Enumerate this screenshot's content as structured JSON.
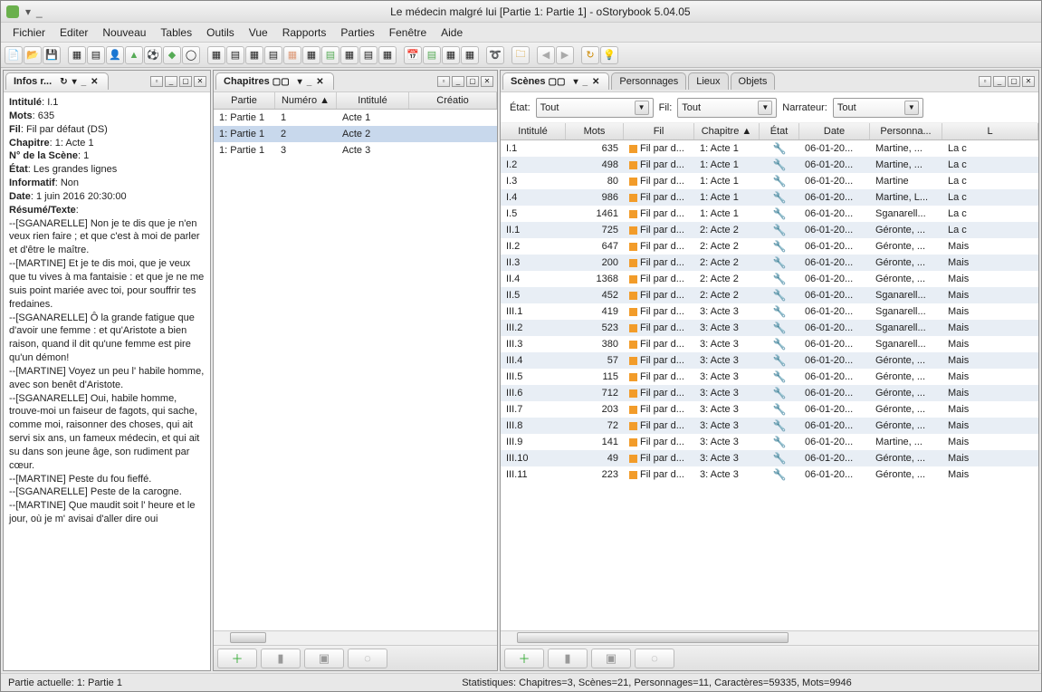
{
  "title": "Le médecin malgré lui [Partie 1: Partie 1] - oStorybook 5.04.05",
  "menubar": [
    "Fichier",
    "Editer",
    "Nouveau",
    "Tables",
    "Outils",
    "Vue",
    "Rapports",
    "Parties",
    "Fenêtre",
    "Aide"
  ],
  "panels": {
    "infos": {
      "title": "Infos r..."
    },
    "chaps": {
      "title": "Chapitres"
    },
    "scenes": {
      "tabs": [
        "Scènes",
        "Personnages",
        "Lieux",
        "Objets"
      ]
    }
  },
  "info": {
    "intitule_lbl": "Intitulé",
    "intitule": "I.1",
    "mots_lbl": "Mots",
    "mots": "635",
    "fil_lbl": "Fil",
    "fil": "Fil par défaut (DS)",
    "chapitre_lbl": "Chapitre",
    "chapitre": "1: Acte 1",
    "numscene_lbl": "N° de la Scène",
    "numscene": "1",
    "etat_lbl": "État",
    "etat": "Les grandes lignes",
    "informatif_lbl": "Informatif",
    "informatif": "Non",
    "date_lbl": "Date",
    "date": "1 juin 2016 20:30:00",
    "resume_lbl": "Résumé/Texte",
    "body": "--[SGANARELLE] Non je te dis que je n'en veux rien faire ; et que c'est à moi de parler et d'être le maître.\n--[MARTINE] Et je te dis moi, que je veux que tu vives à ma fantaisie : et que je ne me suis point mariée avec toi, pour souffrir tes fredaines.\n--[SGANARELLE] Ô la grande fatigue que d'avoir une femme : et qu'Aristote a bien raison, quand il dit qu'une femme est pire qu'un démon!\n--[MARTINE] Voyez un peu l' habile homme, avec son benêt d'Aristote.\n--[SGANARELLE] Oui, habile homme, trouve-moi un faiseur de fagots, qui sache, comme moi, raisonner des choses, qui ait servi six ans, un fameux médecin, et qui ait su dans son jeune âge, son rudiment par cœur.\n--[MARTINE] Peste du fou fieffé.\n--[SGANARELLE] Peste de la carogne.\n--[MARTINE] Que maudit soit l' heure et le jour, où je m' avisai d'aller dire oui"
  },
  "chap_cols": {
    "partie": "Partie",
    "num": "Numéro ▲",
    "int": "Intitulé",
    "cre": "Créatio"
  },
  "chapters": [
    {
      "partie": "1: Partie 1",
      "num": "1",
      "int": "Acte 1"
    },
    {
      "partie": "1: Partie 1",
      "num": "2",
      "int": "Acte 2"
    },
    {
      "partie": "1: Partie 1",
      "num": "3",
      "int": "Acte 3"
    }
  ],
  "filters": {
    "etat_lbl": "État:",
    "etat": "Tout",
    "fil_lbl": "Fil:",
    "fil": "Tout",
    "narr_lbl": "Narrateur:",
    "narr": "Tout"
  },
  "scene_cols": {
    "int": "Intitulé",
    "mots": "Mots",
    "fil": "Fil",
    "chap": "Chapitre ▲",
    "etat": "État",
    "date": "Date",
    "pers": "Personna...",
    "lieu": "L"
  },
  "scenes": [
    {
      "int": "I.1",
      "mots": "635",
      "fil": "Fil par d...",
      "chap": "1: Acte 1",
      "date": "06-01-20...",
      "pers": "Martine, ...",
      "lieu": "La c"
    },
    {
      "int": "I.2",
      "mots": "498",
      "fil": "Fil par d...",
      "chap": "1: Acte 1",
      "date": "06-01-20...",
      "pers": "Martine, ...",
      "lieu": "La c"
    },
    {
      "int": "I.3",
      "mots": "80",
      "fil": "Fil par d...",
      "chap": "1: Acte 1",
      "date": "06-01-20...",
      "pers": "Martine",
      "lieu": "La c"
    },
    {
      "int": "I.4",
      "mots": "986",
      "fil": "Fil par d...",
      "chap": "1: Acte 1",
      "date": "06-01-20...",
      "pers": "Martine, L...",
      "lieu": "La c"
    },
    {
      "int": "I.5",
      "mots": "1461",
      "fil": "Fil par d...",
      "chap": "1: Acte 1",
      "date": "06-01-20...",
      "pers": "Sganarell...",
      "lieu": "La c"
    },
    {
      "int": "II.1",
      "mots": "725",
      "fil": "Fil par d...",
      "chap": "2: Acte 2",
      "date": "06-01-20...",
      "pers": "Géronte, ...",
      "lieu": "La c"
    },
    {
      "int": "II.2",
      "mots": "647",
      "fil": "Fil par d...",
      "chap": "2: Acte 2",
      "date": "06-01-20...",
      "pers": "Géronte, ...",
      "lieu": "Mais"
    },
    {
      "int": "II.3",
      "mots": "200",
      "fil": "Fil par d...",
      "chap": "2: Acte 2",
      "date": "06-01-20...",
      "pers": "Géronte, ...",
      "lieu": "Mais"
    },
    {
      "int": "II.4",
      "mots": "1368",
      "fil": "Fil par d...",
      "chap": "2: Acte 2",
      "date": "06-01-20...",
      "pers": "Géronte, ...",
      "lieu": "Mais"
    },
    {
      "int": "II.5",
      "mots": "452",
      "fil": "Fil par d...",
      "chap": "2: Acte 2",
      "date": "06-01-20...",
      "pers": "Sganarell...",
      "lieu": "Mais"
    },
    {
      "int": "III.1",
      "mots": "419",
      "fil": "Fil par d...",
      "chap": "3: Acte 3",
      "date": "06-01-20...",
      "pers": "Sganarell...",
      "lieu": "Mais"
    },
    {
      "int": "III.2",
      "mots": "523",
      "fil": "Fil par d...",
      "chap": "3: Acte 3",
      "date": "06-01-20...",
      "pers": "Sganarell...",
      "lieu": "Mais"
    },
    {
      "int": "III.3",
      "mots": "380",
      "fil": "Fil par d...",
      "chap": "3: Acte 3",
      "date": "06-01-20...",
      "pers": "Sganarell...",
      "lieu": "Mais"
    },
    {
      "int": "III.4",
      "mots": "57",
      "fil": "Fil par d...",
      "chap": "3: Acte 3",
      "date": "06-01-20...",
      "pers": "Géronte, ...",
      "lieu": "Mais"
    },
    {
      "int": "III.5",
      "mots": "115",
      "fil": "Fil par d...",
      "chap": "3: Acte 3",
      "date": "06-01-20...",
      "pers": "Géronte, ...",
      "lieu": "Mais"
    },
    {
      "int": "III.6",
      "mots": "712",
      "fil": "Fil par d...",
      "chap": "3: Acte 3",
      "date": "06-01-20...",
      "pers": "Géronte, ...",
      "lieu": "Mais"
    },
    {
      "int": "III.7",
      "mots": "203",
      "fil": "Fil par d...",
      "chap": "3: Acte 3",
      "date": "06-01-20...",
      "pers": "Géronte, ...",
      "lieu": "Mais"
    },
    {
      "int": "III.8",
      "mots": "72",
      "fil": "Fil par d...",
      "chap": "3: Acte 3",
      "date": "06-01-20...",
      "pers": "Géronte, ...",
      "lieu": "Mais"
    },
    {
      "int": "III.9",
      "mots": "141",
      "fil": "Fil par d...",
      "chap": "3: Acte 3",
      "date": "06-01-20...",
      "pers": "Martine, ...",
      "lieu": "Mais"
    },
    {
      "int": "III.10",
      "mots": "49",
      "fil": "Fil par d...",
      "chap": "3: Acte 3",
      "date": "06-01-20...",
      "pers": "Géronte, ...",
      "lieu": "Mais"
    },
    {
      "int": "III.11",
      "mots": "223",
      "fil": "Fil par d...",
      "chap": "3: Acte 3",
      "date": "06-01-20...",
      "pers": "Géronte, ...",
      "lieu": "Mais"
    }
  ],
  "status": {
    "partie": "Partie actuelle: 1: Partie 1",
    "stats": "Statistiques: Chapitres=3,  Scènes=21,  Personnages=11,  Caractères=59335,  Mots=9946"
  }
}
